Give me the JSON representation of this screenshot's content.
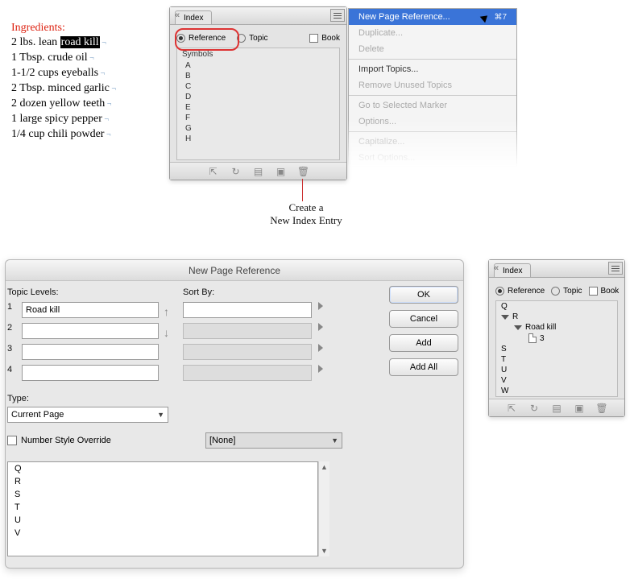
{
  "ingredients": {
    "heading": "Ingredients:",
    "lines": [
      {
        "pre": "2 lbs. lean ",
        "hl": "road kill",
        "post": ""
      },
      {
        "pre": "1 Tbsp. crude oil",
        "hl": "",
        "post": ""
      },
      {
        "pre": "1-1/2 cups eyeballs",
        "hl": "",
        "post": ""
      },
      {
        "pre": "2 Tbsp. minced garlic",
        "hl": "",
        "post": ""
      },
      {
        "pre": "2 dozen yellow teeth",
        "hl": "",
        "post": ""
      },
      {
        "pre": "1 large spicy pepper",
        "hl": "",
        "post": ""
      },
      {
        "pre": "1/4 cup chili powder",
        "hl": "",
        "post": ""
      }
    ]
  },
  "index_panel_top": {
    "tab": "Index",
    "radio_reference": "Reference",
    "radio_topic": "Topic",
    "chk_book": "Book",
    "symbols_header": "Symbols",
    "letters": [
      "A",
      "B",
      "C",
      "D",
      "E",
      "F",
      "G",
      "H"
    ]
  },
  "flyout_menu": {
    "items": [
      {
        "label": "New Page Reference...",
        "shortcut": "⌘7",
        "sel": true
      },
      {
        "label": "Duplicate...",
        "dis": true
      },
      {
        "label": "Delete",
        "dis": true
      },
      {
        "sep": true
      },
      {
        "label": "Import Topics..."
      },
      {
        "label": "Remove Unused Topics",
        "dis": true
      },
      {
        "sep": true
      },
      {
        "label": "Go to Selected Marker",
        "dis": true
      },
      {
        "label": "Options...",
        "dis": true
      },
      {
        "sep": true
      },
      {
        "label": "Capitalize...",
        "dis": true
      },
      {
        "label": "Sort Options...",
        "dis": true
      }
    ]
  },
  "callout": {
    "line1": "Create a",
    "line2": "New Index Entry"
  },
  "dialog": {
    "title": "New Page Reference",
    "topic_levels_label": "Topic Levels:",
    "sort_by_label": "Sort By:",
    "rows": [
      "1",
      "2",
      "3",
      "4"
    ],
    "level1_value": "Road kill",
    "type_label": "Type:",
    "type_value": "Current Page",
    "nso_label": "Number Style Override",
    "nso_value": "[None]",
    "preview_letters": [
      "Q",
      "R",
      "S",
      "T",
      "U",
      "V"
    ],
    "buttons": {
      "ok": "OK",
      "cancel": "Cancel",
      "add": "Add",
      "addall": "Add All"
    }
  },
  "index_panel_right": {
    "tab": "Index",
    "radio_reference": "Reference",
    "radio_topic": "Topic",
    "chk_book": "Book",
    "rows_before": [
      "Q"
    ],
    "expanded_letter": "R",
    "entry_name": "Road kill",
    "entry_page": "3",
    "rows_after": [
      "S",
      "T",
      "U",
      "V",
      "W"
    ]
  }
}
